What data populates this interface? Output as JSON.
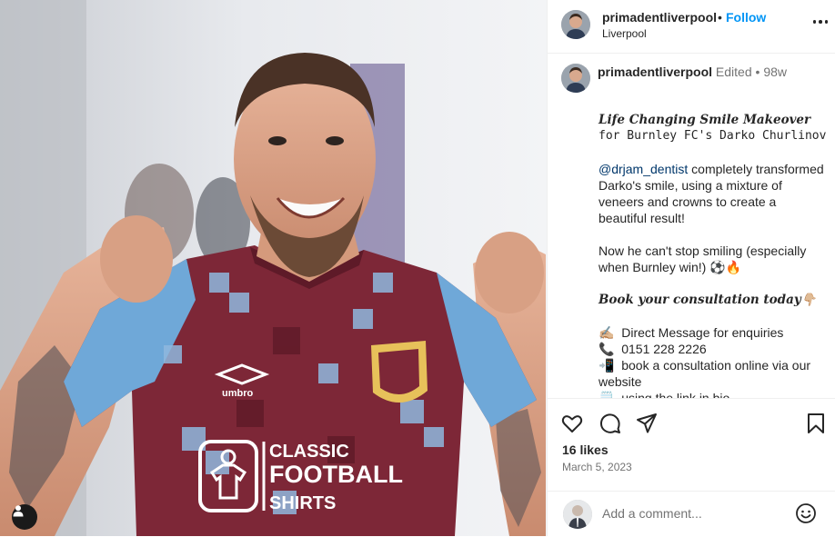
{
  "post": {
    "username": "primadentliverpool",
    "separator": "•",
    "follow_label": "Follow",
    "location": "Liverpool"
  },
  "caption": {
    "username": "primadentliverpool",
    "edited_label": "Edited",
    "meta_separator": "•",
    "time_ago": "98w",
    "title": "Life Changing Smile Makeover",
    "subtitle": "for Burnley FC's Darko Churlinov",
    "mention": "@drjam_dentist",
    "body1": " completely transformed Darko's smile, using a mixture of veneers and crowns to create a beautiful result!",
    "body2": "Now he can't stop smiling (especially when Burnley win!) ⚽🔥",
    "cta": "Book your consultation today👇🏼",
    "items": [
      {
        "icon": "✍🏼",
        "text": "Direct Message for enquiries"
      },
      {
        "icon": "📞",
        "text": "0151 228 2226"
      },
      {
        "icon": "📲",
        "text": "book a consultation online via our website"
      },
      {
        "icon": "🗒️",
        "text": "using the link in bio"
      }
    ]
  },
  "engagement": {
    "likes": "16 likes",
    "date": "March 5, 2023"
  },
  "comment": {
    "placeholder": "Add a comment..."
  },
  "image": {
    "shirt_brand": "umbro",
    "sponsor_line1": "CLASSIC",
    "sponsor_line2": "FOOTBALL",
    "sponsor_line3": "SHIRTS"
  },
  "icons": {
    "heart": "heart-icon",
    "comment": "comment-icon",
    "share": "share-icon",
    "save": "bookmark-icon",
    "emoji": "emoji-icon",
    "tag": "user-tag-icon",
    "more": "more-options-icon"
  },
  "colors": {
    "follow": "#0095f6",
    "text": "#262626",
    "muted": "#737373",
    "mention": "#00376b",
    "claret": "#7d2737",
    "sky_blue": "#6fa8d8"
  }
}
